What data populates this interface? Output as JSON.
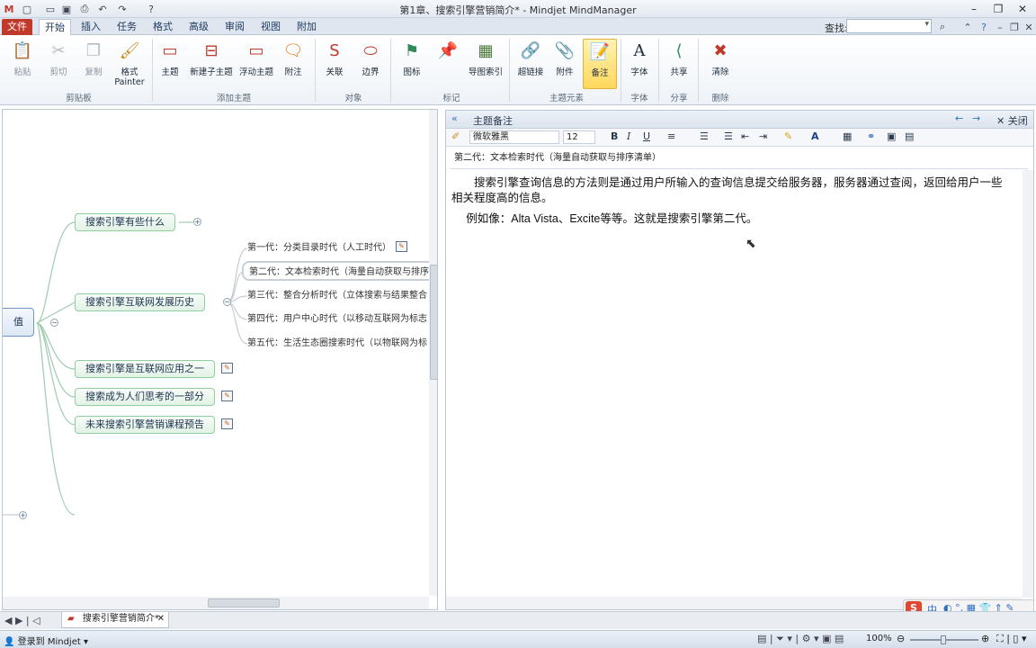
{
  "window": {
    "title": "第1章、搜索引擎营销简介* - Mindjet MindManager"
  },
  "tabs": [
    "文件",
    "开始",
    "插入",
    "任务",
    "格式",
    "高级",
    "审阅",
    "视图",
    "附加"
  ],
  "search_label": "查找:",
  "ribbon": {
    "buttons": {
      "paste": "粘贴",
      "cut": "剪切",
      "copy": "复制",
      "format_painter_1": "格式",
      "format_painter_2": "Painter",
      "topic": "主题",
      "subtopic": "新建子主题",
      "floating": "浮动主题",
      "callout": "附注",
      "relation": "关联",
      "boundary": "边界",
      "icon": "图标",
      "map_index": "导图索引",
      "hyperlink": "超链接",
      "attachment": "附件",
      "notes": "备注",
      "font": "字体",
      "share": "共享",
      "clear": "清除"
    },
    "groups": {
      "clipboard": "剪贴板",
      "add_topic": "添加主题",
      "objects": "对象",
      "markers": "标记",
      "topic_elements": "主题元素",
      "font": "字体",
      "share": "分享",
      "delete": "删除"
    }
  },
  "map": {
    "central_fragment": "值",
    "topics": [
      "搜索引擎有些什么",
      "搜索引擎互联网发展历史",
      "搜索引擎是互联网应用之一",
      "搜索成为人们思考的一部分",
      "未来搜索引擎营销课程预告"
    ],
    "subtopics": [
      "第一代：分类目录时代（人工时代）",
      "第二代：文本检索时代（海量自动获取与排序清",
      "第三代：整合分析时代（立体搜索与结果整合",
      "第四代：用户中心时代（以移动互联网为标志",
      "第五代：生活生态圈搜索时代（以物联网为标"
    ]
  },
  "note_pane": {
    "header": "主题备注",
    "close": "关闭",
    "font_name": "微软雅黑",
    "font_size": "12",
    "subject": "第二代：文本检索时代（海量自动获取与排序清单）",
    "paragraph1": "搜索引擎查询信息的方法则是通过用户所输入的查询信息提交给服务器，服务器通过查阅，返回给用户一些相关程度高的信息。",
    "paragraph2": "例如像：Alta Vista、Excite等等。这就是搜索引擎第二代。"
  },
  "doc_tab": "搜索引擎营销简介*",
  "status": {
    "login": "登录到 Mindjet",
    "zoom": "100%",
    "ime": "中"
  },
  "colors": {
    "file_tab": "#c0392b",
    "topic_border": "#8fcf9e",
    "notes_selected": "#ffd75c"
  }
}
